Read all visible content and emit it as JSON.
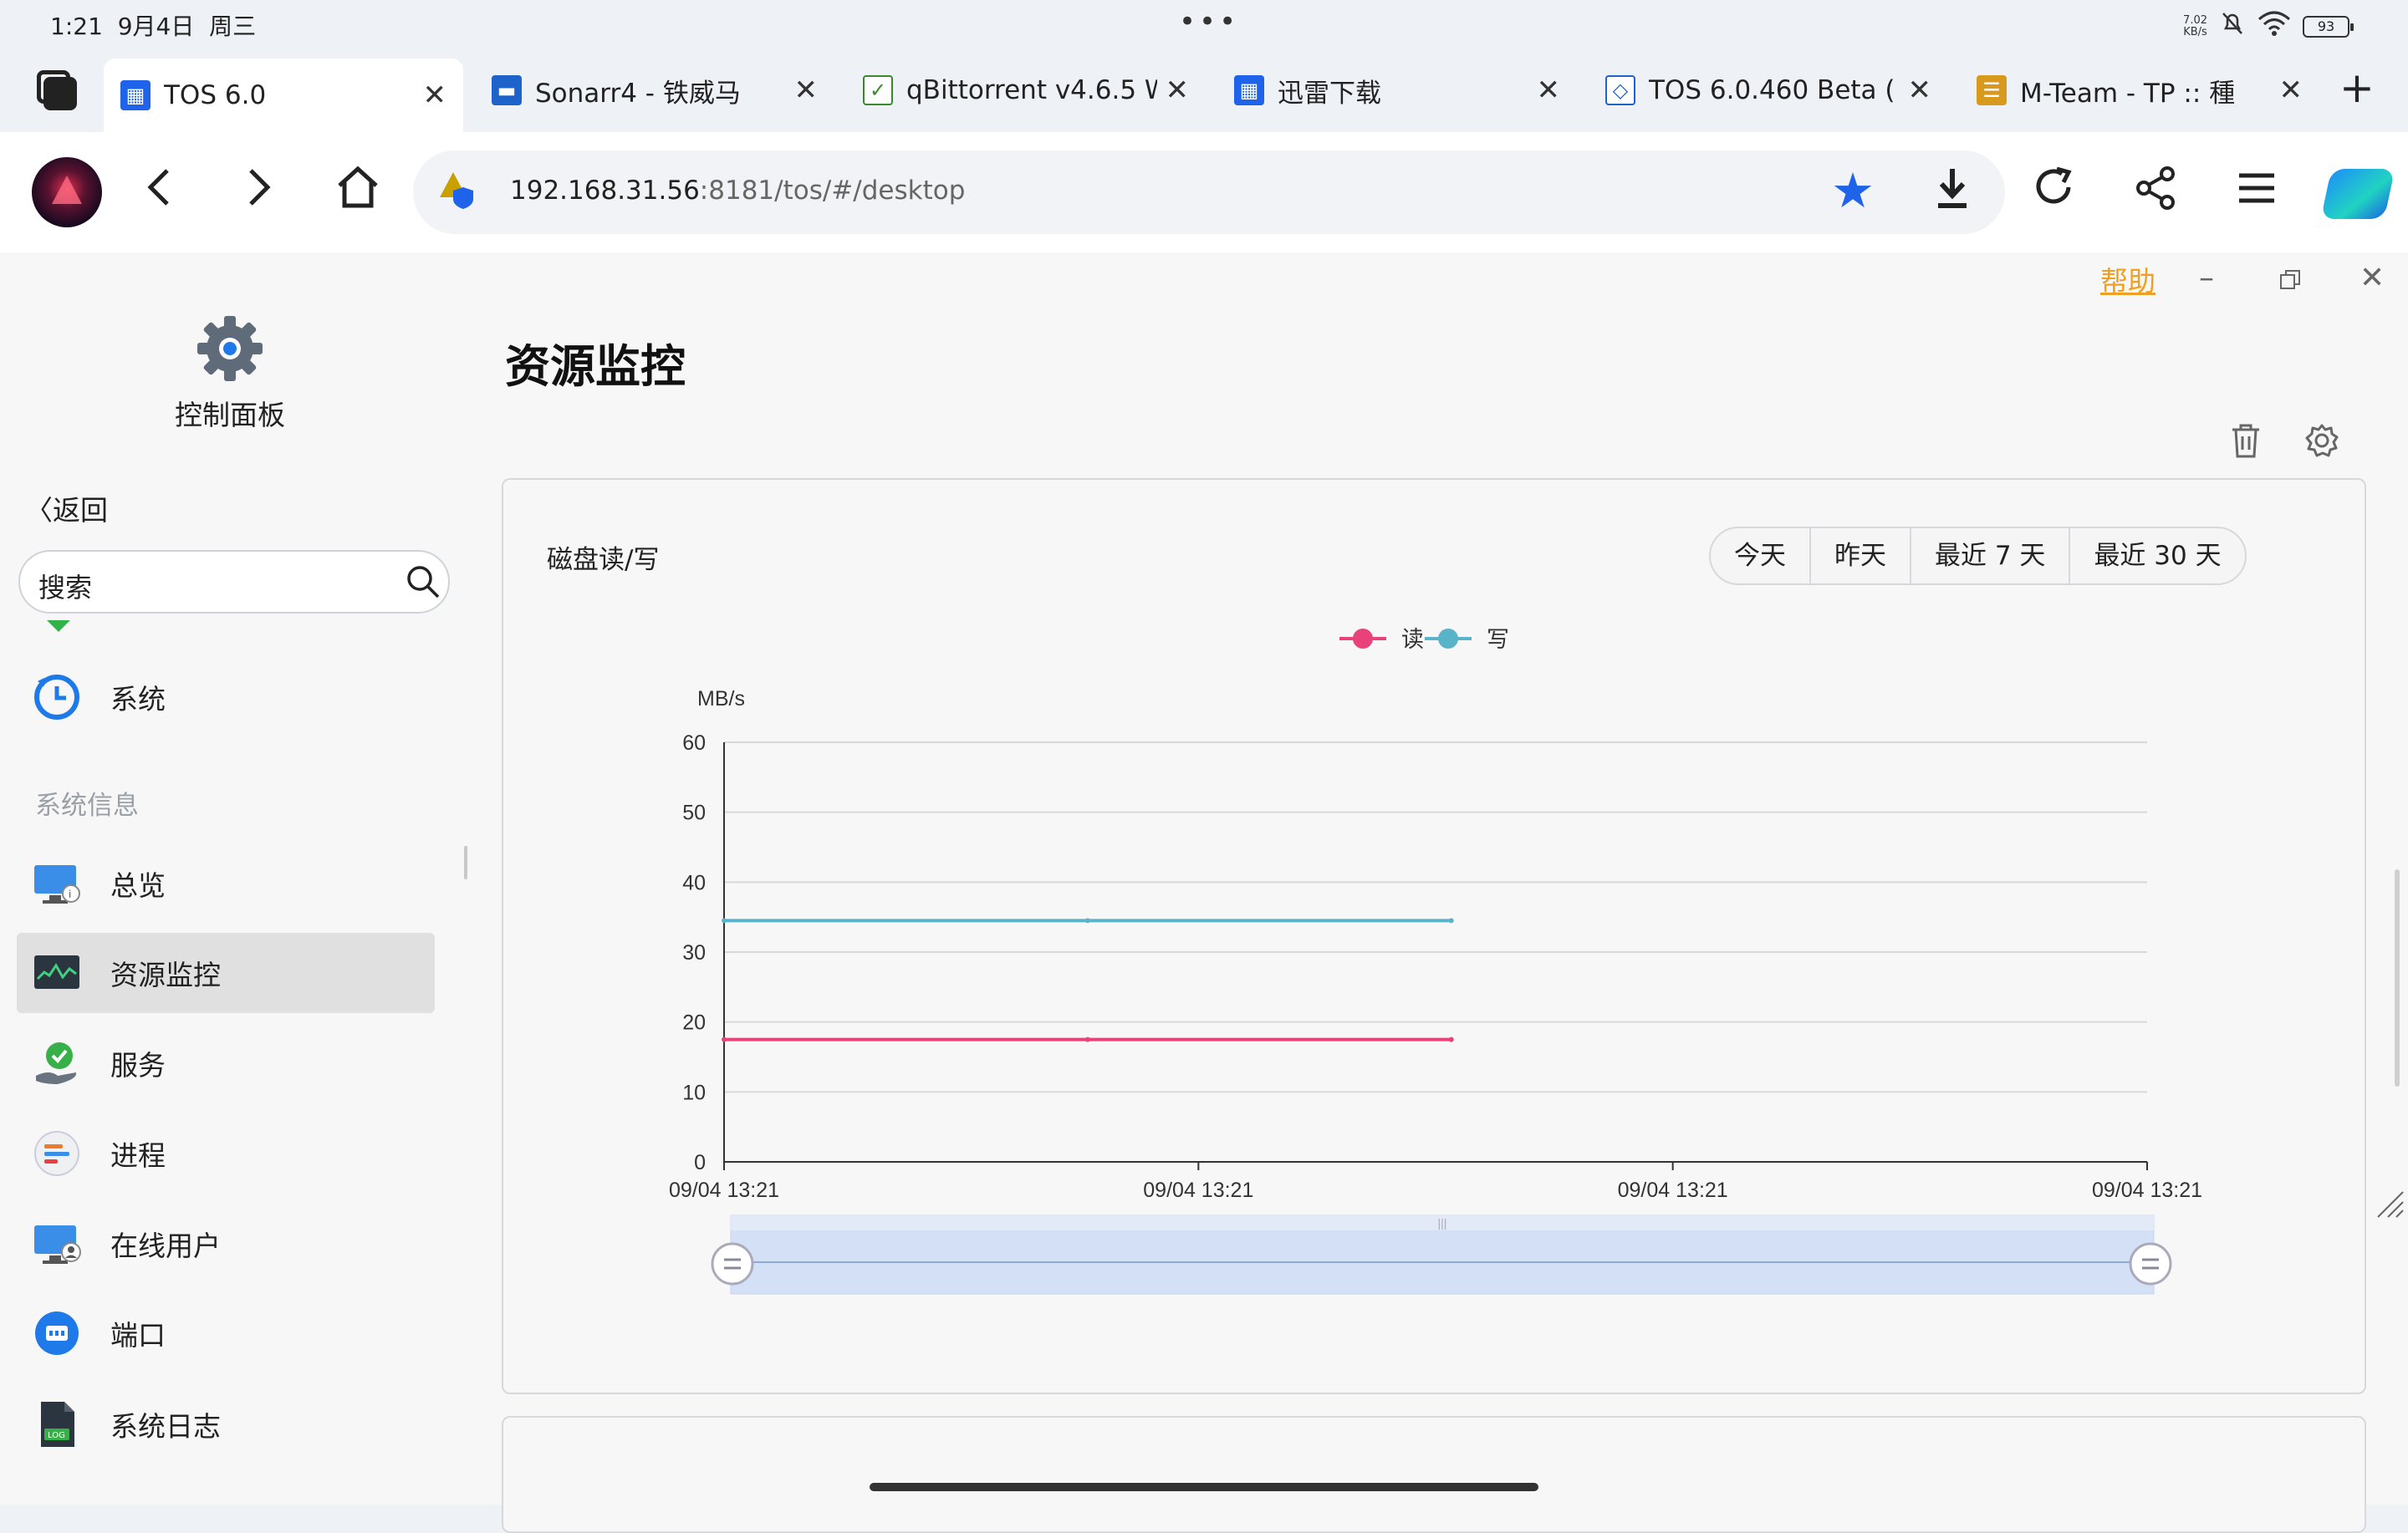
{
  "status_bar": {
    "time": "1:21",
    "date": "9月4日",
    "weekday": "周三",
    "net_speed_value": "7.02",
    "net_speed_unit": "KB/s",
    "battery": "93"
  },
  "tabs": [
    {
      "title": "TOS 6.0",
      "active": true,
      "icon": "tos-icon",
      "color": "#1e63e9"
    },
    {
      "title": "Sonarr4 - 铁威马",
      "active": false,
      "icon": "sonarr-icon",
      "color": "#1e63c9"
    },
    {
      "title": "qBittorrent v4.6.5 W",
      "active": false,
      "icon": "qbittorrent-icon",
      "color": "#3a8a2c"
    },
    {
      "title": "迅雷下载",
      "active": false,
      "icon": "thunder-icon",
      "color": "#1e63e9"
    },
    {
      "title": "TOS 6.0.460 Beta (",
      "active": false,
      "icon": "tos-box-icon",
      "color": "#1e63c9"
    },
    {
      "title": "M-Team - TP :: 種",
      "active": false,
      "icon": "mteam-icon",
      "color": "#d89a1c"
    }
  ],
  "address": {
    "host": "192.168.31.56",
    "path": ":8181/tos/#/desktop"
  },
  "window": {
    "help": "帮助"
  },
  "sidebar": {
    "app_name": "控制面板",
    "back": "返回",
    "search_placeholder": "搜索",
    "top_item": "系统",
    "group_title": "系统信息",
    "items": [
      {
        "label": "总览",
        "icon": "monitor-info-icon"
      },
      {
        "label": "资源监控",
        "icon": "resource-monitor-icon",
        "active": true
      },
      {
        "label": "服务",
        "icon": "service-check-icon"
      },
      {
        "label": "进程",
        "icon": "process-icon"
      },
      {
        "label": "在线用户",
        "icon": "online-user-icon"
      },
      {
        "label": "端口",
        "icon": "port-icon"
      },
      {
        "label": "系统日志",
        "icon": "log-file-icon"
      }
    ]
  },
  "main": {
    "page_title": "资源监控",
    "card_title": "磁盘读/写",
    "ranges": [
      "今天",
      "昨天",
      "最近 7 天",
      "最近 30 天"
    ]
  },
  "chart_data": {
    "type": "line",
    "title": "磁盘读/写",
    "ylabel": "MB/s",
    "ylim": [
      0,
      60
    ],
    "yticks": [
      0,
      10,
      20,
      30,
      40,
      50,
      60
    ],
    "x_tick_labels": [
      "09/04 13:21",
      "09/04 13:21",
      "09/04 13:21",
      "09/04 13:21"
    ],
    "legend_position": "top-center",
    "grid": true,
    "series": [
      {
        "name": "读",
        "color": "#e9417a",
        "values": [
          17.5,
          17.5,
          17.5
        ]
      },
      {
        "name": "写",
        "color": "#5ab4c9",
        "values": [
          34.5,
          34.5,
          34.5
        ]
      }
    ],
    "data_zoom": {
      "start": 0,
      "end": 1
    }
  }
}
